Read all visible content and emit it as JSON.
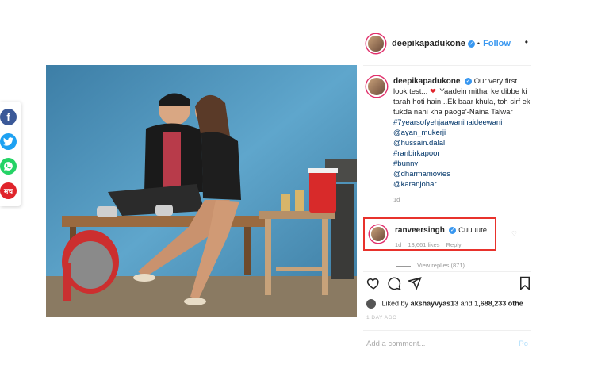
{
  "share_rail": {
    "facebook_glyph": "f",
    "hindi_glyph": "मच"
  },
  "post": {
    "author": "deepikapadukone",
    "follow_label": "Follow",
    "more_glyph": "•",
    "caption": {
      "author": "deepikapadukone",
      "text_before_heart": "Our very first look test...",
      "heart_glyph": "❤",
      "text_after_heart": "'Yaadein mithai ke dibbe ki tarah hoti hain...Ek baar khula, toh sirf ek tukda nahi kha paoge'-Naina Talwar",
      "tags": [
        "#7yearsofyehjaawanihaideewani",
        "@ayan_mukerji",
        "@hussain.dalal",
        "#ranbirkapoor",
        "#bunny",
        "@dharmamovies",
        "@karanjohar"
      ],
      "time": "1d"
    },
    "highlighted_comment": {
      "author": "ranveersingh",
      "text": "Cuuuute",
      "time": "1d",
      "likes": "13,661 likes",
      "reply_label": "Reply"
    },
    "view_replies": "View replies (871)",
    "liked_by": {
      "prefix": "Liked by",
      "user": "akshayvyas13",
      "connector": "and",
      "count": "1,688,233 othe"
    },
    "date": "1 DAY AGO",
    "add_comment_placeholder": "Add a comment...",
    "post_button": "Po"
  },
  "colors": {
    "instagram_blue": "#3897f0",
    "highlight_red": "#e8322c",
    "facebook": "#3b5998",
    "twitter": "#1da1f2",
    "whatsapp": "#25d366"
  },
  "icons": [
    "facebook-icon",
    "twitter-icon",
    "whatsapp-icon",
    "hindi-share-icon",
    "verified-icon",
    "heart-icon",
    "comment-icon",
    "share-icon",
    "bookmark-icon"
  ]
}
